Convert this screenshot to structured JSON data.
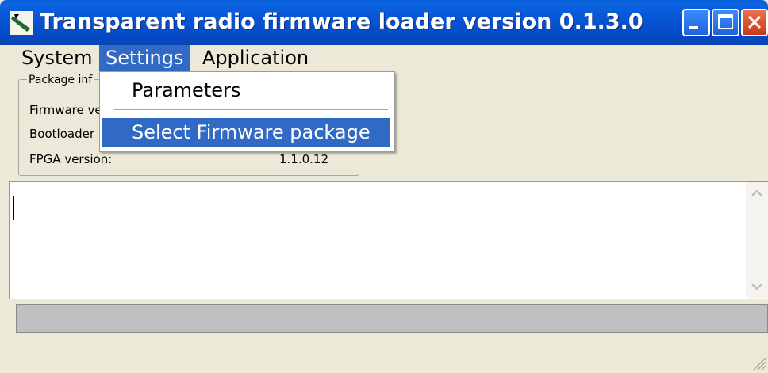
{
  "window": {
    "title": "Transparent radio firmware loader version 0.1.3.0",
    "colors": {
      "title_bar": "#0656d6",
      "highlight": "#316ac5",
      "face": "#ece9d8"
    }
  },
  "menubar": {
    "items": [
      {
        "label": "System"
      },
      {
        "label": "Settings"
      },
      {
        "label": "Application"
      }
    ],
    "active": "Settings"
  },
  "settings_menu": {
    "items": [
      {
        "label": "Parameters"
      },
      {
        "label": "Select Firmware package"
      }
    ],
    "highlighted": "Select Firmware package"
  },
  "package_info": {
    "legend": "Package inf",
    "rows": [
      {
        "label": "Firmware ve",
        "value": ""
      },
      {
        "label": "Bootloader",
        "value": ""
      },
      {
        "label": "FPGA version:",
        "value": "1.1.0.12"
      }
    ]
  },
  "log": {
    "text": ""
  },
  "icons": {
    "app": "app-logo-icon",
    "minimize": "minimize-icon",
    "maximize": "maximize-icon",
    "close": "close-icon",
    "scroll_up": "scroll-up-arrow-icon",
    "scroll_down": "scroll-down-arrow-icon",
    "grip": "resize-grip-icon"
  }
}
